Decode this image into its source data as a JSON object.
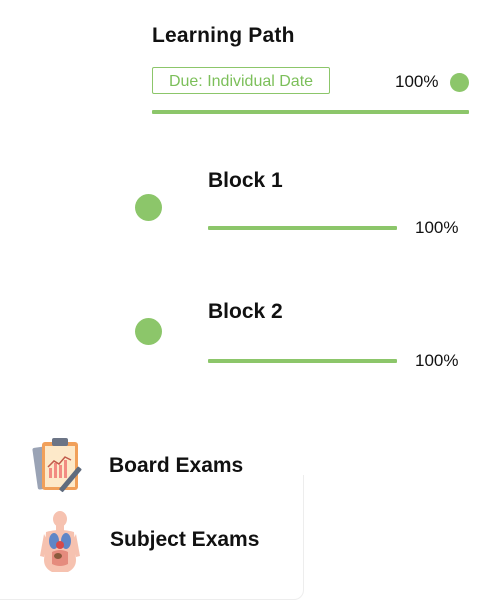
{
  "learning_path": {
    "title": "Learning Path",
    "due_label": "Due: Individual Date",
    "progress_text": "100%",
    "progress": 1.0
  },
  "blocks": [
    {
      "title": "Block 1",
      "progress_text": "100%",
      "progress": 1.0
    },
    {
      "title": "Block 2",
      "progress_text": "100%",
      "progress": 1.0
    }
  ],
  "exams": [
    {
      "label": "Board Exams",
      "icon": "clipboard-chart-icon"
    },
    {
      "label": "Subject Exams",
      "icon": "anatomy-body-icon"
    }
  ],
  "colors": {
    "accent": "#8cc66a"
  }
}
